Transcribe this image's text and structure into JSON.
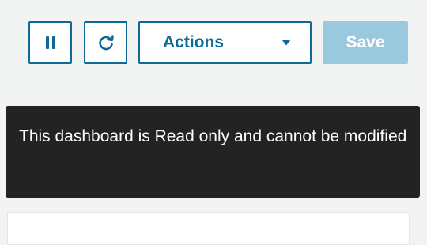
{
  "toolbar": {
    "pause_icon": "pause-icon",
    "refresh_icon": "refresh-icon",
    "actions_label": "Actions",
    "actions_caret_icon": "caret-down-icon",
    "save_label": "Save"
  },
  "tooltip": {
    "text": "This dashboard is Read only and cannot be modified"
  },
  "colors": {
    "primary": "#0d6a94",
    "save_disabled": "#99c9dd",
    "tooltip_bg": "#232323",
    "page_bg": "#f2f3f3"
  }
}
